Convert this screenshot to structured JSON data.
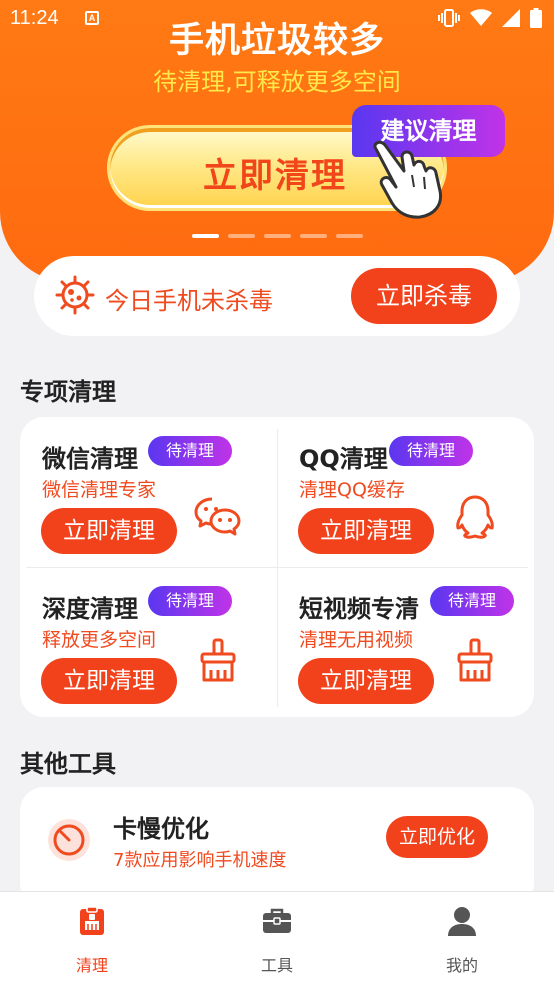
{
  "status_bar": {
    "time": "11:24",
    "notification_icon": "A"
  },
  "hero": {
    "title": "手机垃圾较多",
    "subtitle": "待清理,可释放更多空间",
    "main_button": "立即清理",
    "suggest_badge": "建议清理",
    "carousel_pages": 5,
    "carousel_active": 1
  },
  "virus": {
    "text": "今日手机未杀毒",
    "button": "立即杀毒"
  },
  "special": {
    "title": "专项清理",
    "items": [
      {
        "name": "微信清理",
        "tag": "待清理",
        "desc": "微信清理专家",
        "button": "立即清理",
        "icon": "wechat-icon"
      },
      {
        "name": "QQ清理",
        "tag": "待清理",
        "desc": "清理QQ缓存",
        "button": "立即清理",
        "icon": "qq-icon"
      },
      {
        "name": "深度清理",
        "tag": "待清理",
        "desc": "释放更多空间",
        "button": "立即清理",
        "icon": "broom-icon"
      },
      {
        "name": "短视频专清",
        "tag": "待清理",
        "desc": "清理无用视频",
        "button": "立即清理",
        "icon": "broom-icon"
      }
    ]
  },
  "other": {
    "title": "其他工具",
    "tool": {
      "name": "卡慢优化",
      "desc": "7款应用影响手机速度",
      "button": "立即优化",
      "icon": "speedometer-icon"
    }
  },
  "tabbar": {
    "tabs": [
      {
        "label": "清理",
        "icon": "clean-icon",
        "active": true
      },
      {
        "label": "工具",
        "icon": "toolbox-icon",
        "active": false
      },
      {
        "label": "我的",
        "icon": "user-icon",
        "active": false
      }
    ]
  },
  "colors": {
    "brand_orange": "#ff7a14",
    "button_red": "#f2421c",
    "tag_gradient_start": "#5a37f0",
    "tag_gradient_end": "#c033e8",
    "highlight_yellow": "#ffe84a"
  }
}
